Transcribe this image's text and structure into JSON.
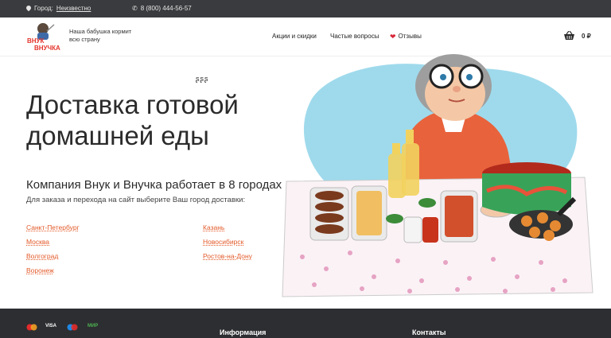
{
  "topbar": {
    "city_prefix": "Город:",
    "city_value": "Неизвестно",
    "phone": "8 (800) 444-56-57"
  },
  "header": {
    "logo_line1": "ВНУК",
    "logo_line2": "ВНУЧКА",
    "tagline": "Наша бабушка кормит всю страну",
    "nav": {
      "promo": "Акции и скидки",
      "faq": "Частые вопросы",
      "reviews": "Отзывы"
    },
    "cart_total": "0 ₽"
  },
  "hero": {
    "title_line1": "Доставка готовой",
    "title_line2": "домашней еды",
    "subtitle": "Компания Внук и Внучка работает в 8 городах",
    "text": "Для заказа и перехода на сайт выберите Ваш город доставки:",
    "cities_col1": [
      "Санкт-Петербург",
      "Москва",
      "Волгоград",
      "Воронеж"
    ],
    "cities_col2": [
      "Казань",
      "Новосибирск",
      "Ростов-на-Дону"
    ]
  },
  "footer": {
    "payments": [
      "VISA",
      "МИР"
    ],
    "info_heading": "Информация",
    "contacts_heading": "Контакты"
  },
  "colors": {
    "topbar": "#3a3b3e",
    "accent_link": "#e35a2a",
    "footer": "#2d2e31",
    "heart": "#d8273a"
  }
}
